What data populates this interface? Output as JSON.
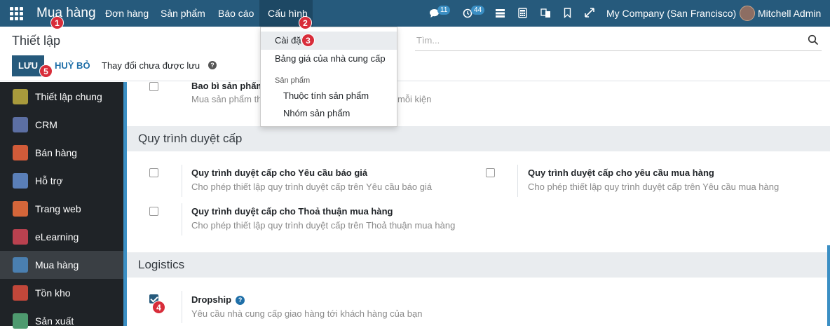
{
  "topbar": {
    "app_title": "Mua hàng",
    "menu": [
      "Đơn hàng",
      "Sản phẩm",
      "Báo cáo",
      "Cấu hình"
    ],
    "messages_count": "11",
    "activities_count": "44",
    "company": "My Company (San Francisco)",
    "user": "Mitchell Admin"
  },
  "control": {
    "page_title": "Thiết lập",
    "search_placeholder": "Tìm...",
    "save": "LƯU",
    "cancel": "HUỶ BỎ",
    "unsaved": "Thay đổi chưa được lưu"
  },
  "dropdown": {
    "items": [
      "Cài đặt",
      "Bảng giá của nhà cung cấp"
    ],
    "section_header": "Sản phẩm",
    "sub_items": [
      "Thuộc tính sản phẩm",
      "Nhóm sản phẩm"
    ]
  },
  "sidebar": {
    "items": [
      {
        "label": "Thiết lập chung",
        "color": "#a89a3c",
        "icon": "gear-icon"
      },
      {
        "label": "CRM",
        "color": "#5c6fa3",
        "icon": "handshake-icon"
      },
      {
        "label": "Bán hàng",
        "color": "#d15b39",
        "icon": "chart-icon"
      },
      {
        "label": "Hỗ trợ",
        "color": "#5a7fb8",
        "icon": "lifebuoy-icon"
      },
      {
        "label": "Trang web",
        "color": "#d4663a",
        "icon": "globe-icon"
      },
      {
        "label": "eLearning",
        "color": "#b9414f",
        "icon": "elearning-icon"
      },
      {
        "label": "Mua hàng",
        "color": "#4a7fb0",
        "icon": "credit-card-icon"
      },
      {
        "label": "Tồn kho",
        "color": "#c1473a",
        "icon": "boxes-icon"
      },
      {
        "label": "Sản xuất",
        "color": "#4e9a6f",
        "icon": "wrench-icon"
      }
    ]
  },
  "content": {
    "partial_option": {
      "title": "Bao bì sản phẩm",
      "desc_start": "Mua sản phẩm th",
      "desc_end": "mỗi kiện"
    },
    "section1": "Quy trình duyệt cấp",
    "options1": [
      {
        "title": "Quy trình duyệt cấp cho Yêu cầu báo giá",
        "desc": "Cho phép thiết lập quy trình duyệt cấp trên Yêu cầu báo giá"
      },
      {
        "title": "Quy trình duyệt cấp cho yêu cầu mua hàng",
        "desc": "Cho phép thiết lập quy trình duyệt cấp trên Yêu cầu mua hàng"
      },
      {
        "title": "Quy trình duyệt cấp cho Thoả thuận mua hàng",
        "desc": "Cho phép thiết lập quy trình duyệt cấp trên Thoả thuận mua hàng"
      }
    ],
    "section2": "Logistics",
    "dropship": {
      "title": "Dropship",
      "desc": "Yêu cầu nhà cung cấp giao hàng tới khách hàng của bạn",
      "checked": true
    }
  },
  "markers": [
    "1",
    "2",
    "3",
    "4",
    "5"
  ]
}
